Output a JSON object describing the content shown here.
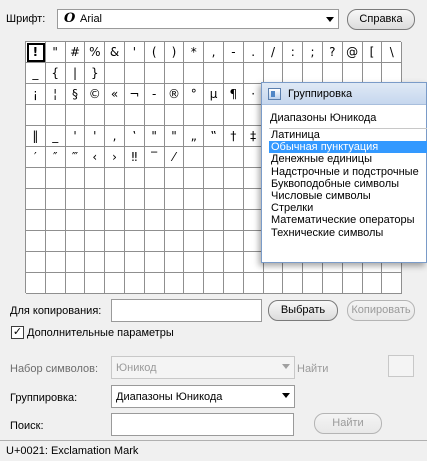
{
  "font": {
    "label": "Шрифт:",
    "glyph": "O",
    "selected": "Arial"
  },
  "help_button": "Справка",
  "grid": {
    "rows": [
      [
        "!",
        "\"",
        "#",
        "%",
        "&",
        "'",
        "(",
        ")",
        "*",
        ",",
        "-",
        ".",
        "/",
        ":",
        ";",
        "?",
        "@",
        "[",
        "\\",
        "]"
      ],
      [
        "_",
        "{",
        "|",
        "}",
        "",
        "",
        "",
        "",
        "",
        "",
        "",
        "",
        "",
        "",
        "",
        "",
        "",
        "",
        "",
        ""
      ],
      [
        "¡",
        "¦",
        "§",
        "©",
        "«",
        "¬",
        "-",
        "®",
        "°",
        "µ",
        "¶",
        "·",
        "",
        "",
        "",
        "",
        "",
        "",
        "",
        ""
      ],
      [
        "",
        "",
        "",
        "",
        "",
        "",
        "",
        "",
        "",
        "",
        "",
        "",
        "",
        "",
        "",
        "",
        "",
        "",
        "",
        ""
      ],
      [
        "‖",
        "_",
        "'",
        "'",
        ",",
        "‛",
        "\"",
        "\"",
        "„",
        "‟",
        "†",
        "‡",
        "•",
        "",
        "",
        "",
        "",
        "",
        "",
        ""
      ],
      [
        "′",
        "″",
        "‴",
        "‹",
        "›",
        "‼",
        "‾",
        "⁄",
        "",
        "",
        "",
        "",
        "",
        "",
        "",
        "",
        "",
        "",
        "",
        ""
      ],
      [
        "",
        "",
        "",
        "",
        "",
        "",
        "",
        "",
        "",
        "",
        "",
        "",
        "",
        "",
        "",
        "",
        "",
        "",
        "",
        ""
      ],
      [
        "",
        "",
        "",
        "",
        "",
        "",
        "",
        "",
        "",
        "",
        "",
        "",
        "",
        "",
        "",
        "",
        "",
        "",
        "",
        ""
      ],
      [
        "",
        "",
        "",
        "",
        "",
        "",
        "",
        "",
        "",
        "",
        "",
        "",
        "",
        "",
        "",
        "",
        "",
        "",
        "",
        ""
      ],
      [
        "",
        "",
        "",
        "",
        "",
        "",
        "",
        "",
        "",
        "",
        "",
        "",
        "",
        "",
        "",
        "",
        "",
        "",
        "",
        ""
      ],
      [
        "",
        "",
        "",
        "",
        "",
        "",
        "",
        "",
        "",
        "",
        "",
        "",
        "",
        "",
        "",
        "",
        "",
        "",
        "",
        ""
      ],
      [
        "",
        "",
        "",
        "",
        "",
        "",
        "",
        "",
        "",
        "",
        "",
        "",
        "",
        "",
        "",
        "",
        "",
        "",
        "",
        ""
      ]
    ]
  },
  "popup": {
    "title": "Группировка",
    "header": "Диапазоны Юникода",
    "items": [
      "Латиница",
      "Обычная пунктуация",
      "Денежные единицы",
      "Надстрочные и подстрочные",
      "Буквоподобные символы",
      "Числовые символы",
      "Стрелки",
      "Математические операторы",
      "Технические символы"
    ]
  },
  "copy": {
    "label": "Для копирования:",
    "value": "",
    "select_button": "Выбрать",
    "copy_button": "Копировать"
  },
  "advanced": {
    "label": "Дополнительные параметры",
    "checked": true
  },
  "charset": {
    "label": "Набор символов:",
    "value": "Юникод",
    "goto_label": "Найти"
  },
  "grouping": {
    "label": "Группировка:",
    "value": "Диапазоны Юникода"
  },
  "search": {
    "label": "Поиск:",
    "value": "",
    "button": "Найти"
  },
  "status": "U+0021: Exclamation Mark"
}
